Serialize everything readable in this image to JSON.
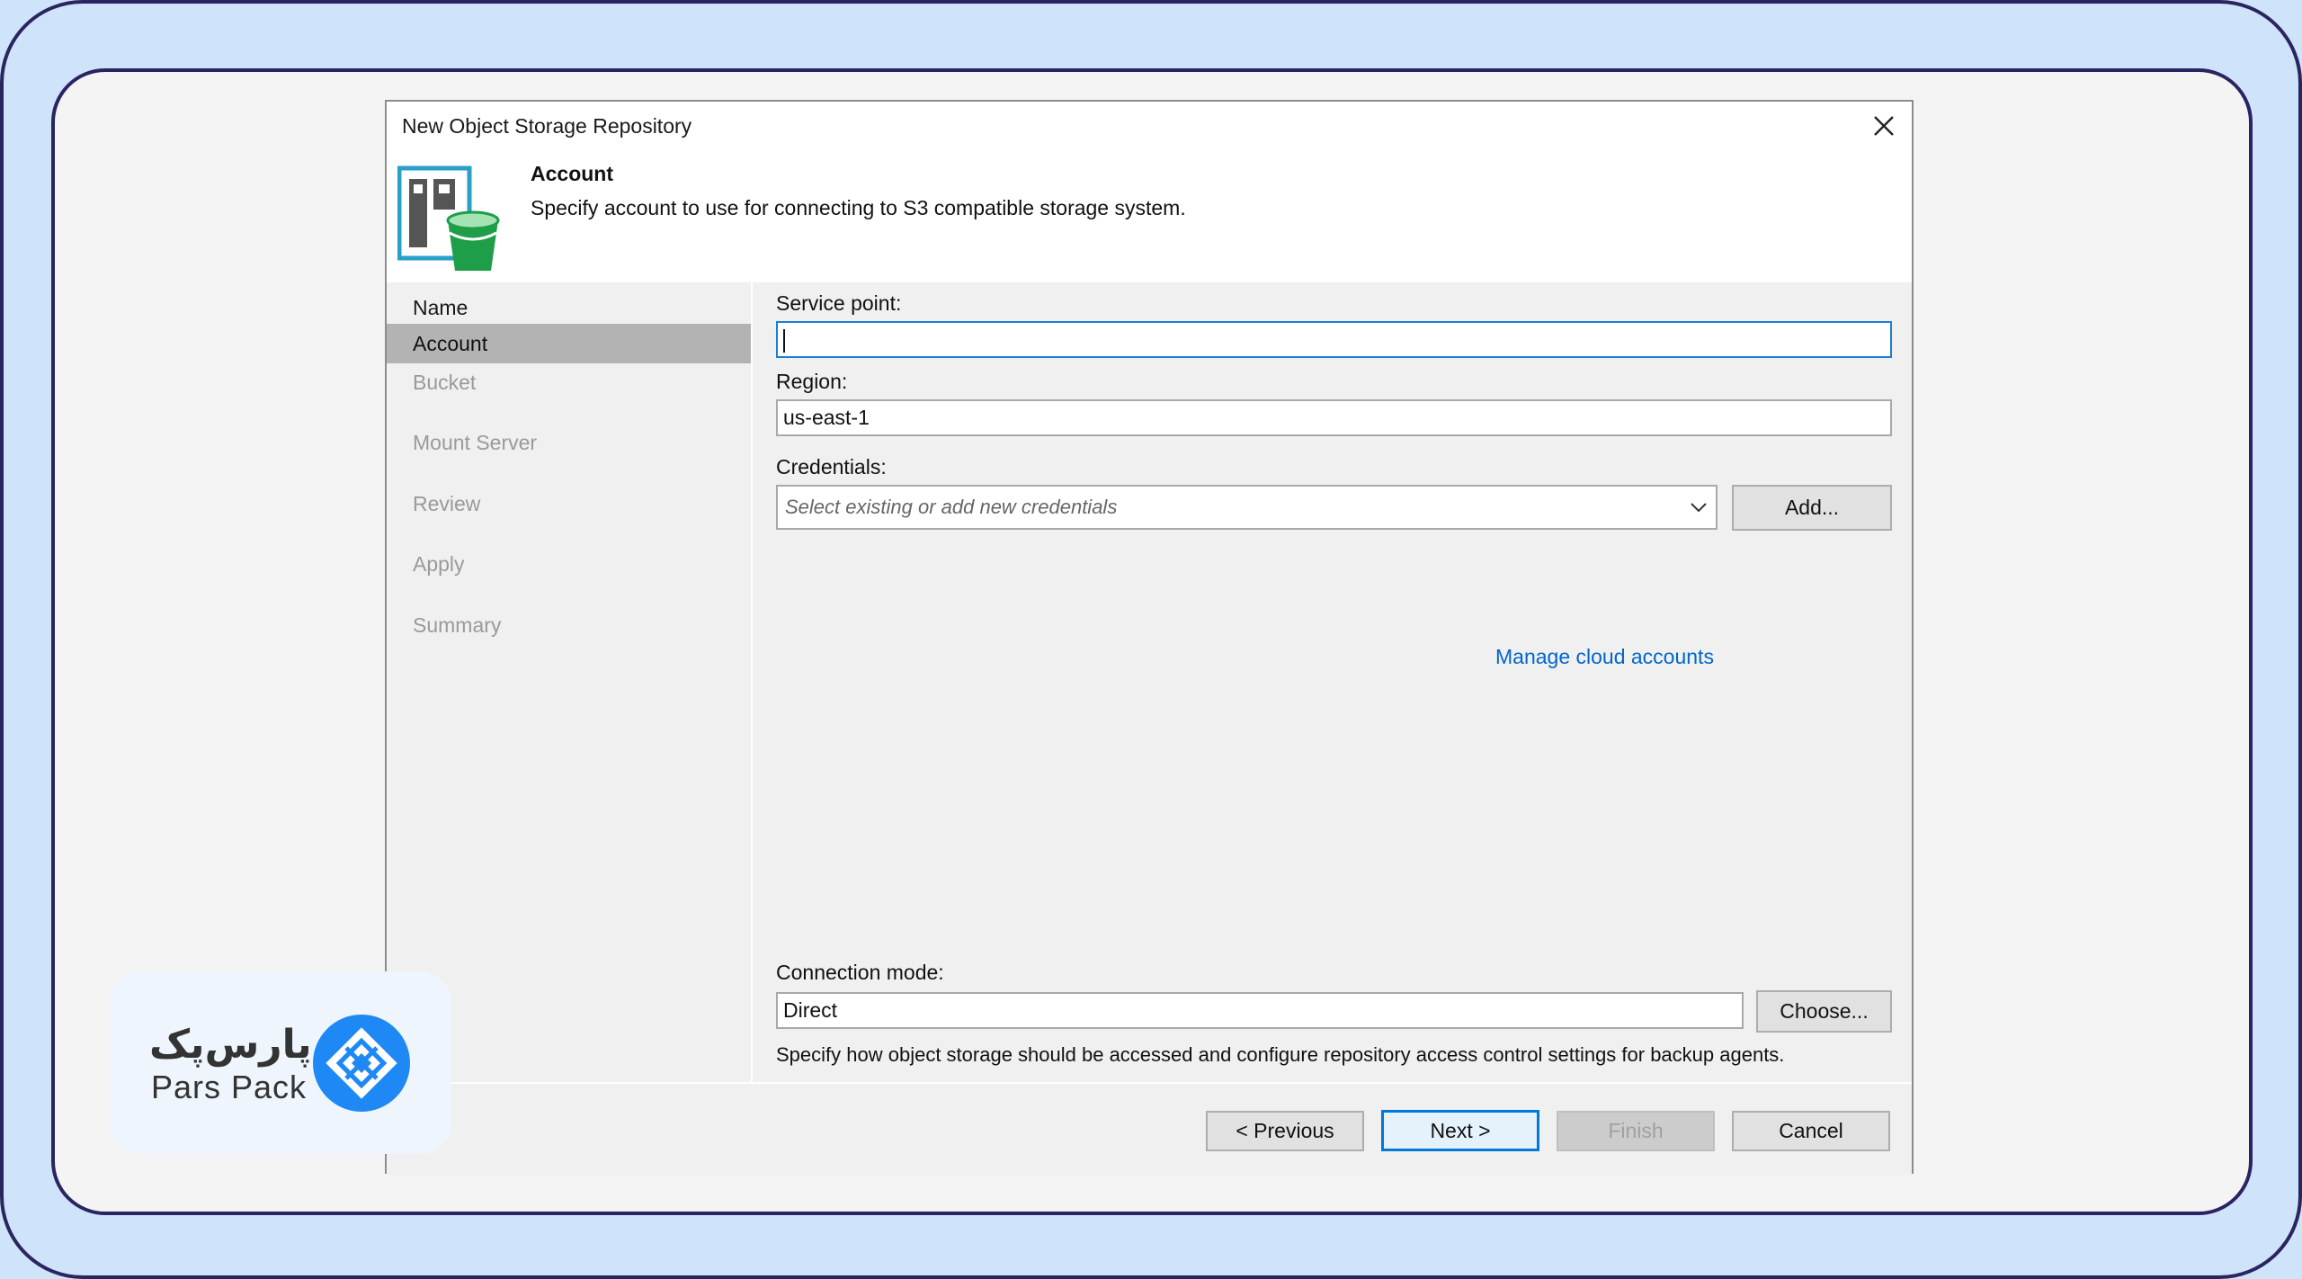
{
  "dialog": {
    "title": "New Object Storage Repository",
    "close_glyph": "✕",
    "step_title": "Account",
    "step_description": "Specify account to use for connecting to S3 compatible storage system.",
    "icon": "object-storage-bucket-icon"
  },
  "sidebar": {
    "items": [
      {
        "label": "Name",
        "state": "done"
      },
      {
        "label": "Account",
        "state": "active"
      },
      {
        "label": "Bucket",
        "state": "pending"
      },
      {
        "label": "Mount Server",
        "state": "pending"
      },
      {
        "label": "Review",
        "state": "pending"
      },
      {
        "label": "Apply",
        "state": "pending"
      },
      {
        "label": "Summary",
        "state": "pending"
      }
    ]
  },
  "form": {
    "service_point_label": "Service point:",
    "service_point_value": "",
    "region_label": "Region:",
    "region_value": "us-east-1",
    "credentials_label": "Credentials:",
    "credentials_placeholder": "Select existing or add new credentials",
    "add_button": "Add...",
    "manage_link": "Manage cloud accounts",
    "connection_mode_label": "Connection mode:",
    "connection_mode_value": "Direct",
    "choose_button": "Choose...",
    "connection_mode_hint": "Specify how object storage should be accessed and configure repository access control settings for backup agents."
  },
  "footer": {
    "previous": "< Previous",
    "next": "Next >",
    "finish": "Finish",
    "cancel": "Cancel"
  },
  "watermark": {
    "persian_text": "پارس‌پک",
    "english_text": "Pars Pack",
    "brand_color": "#1e88f5"
  },
  "colors": {
    "accent": "#0078d7",
    "link": "#0066cc",
    "outer_border": "#2a2560",
    "background": "#cfe4fb"
  }
}
